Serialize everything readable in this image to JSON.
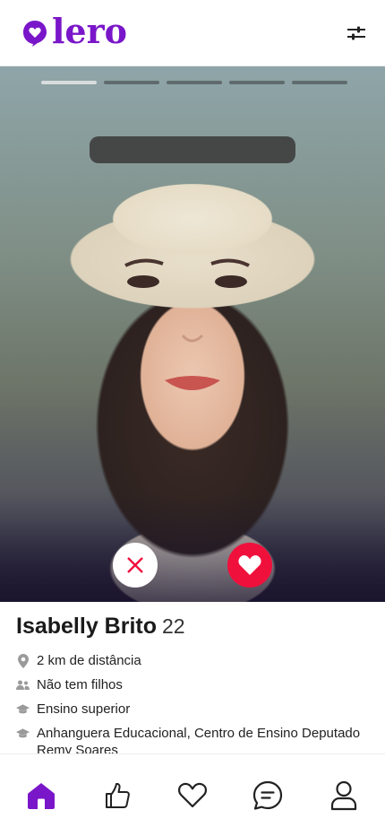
{
  "app": {
    "brand": "lero",
    "brand_color": "#7a16c9"
  },
  "header": {
    "filter_icon": "sliders-icon"
  },
  "photo": {
    "progress_total": 5,
    "progress_active": 0
  },
  "actions": {
    "dislike_icon": "close-icon",
    "like_icon": "heart-icon",
    "like_color": "#f0103c"
  },
  "profile": {
    "name": "Isabelly Brito",
    "age": "22",
    "details": [
      {
        "icon": "location-pin-icon",
        "text": "2 km de distância"
      },
      {
        "icon": "people-icon",
        "text": "Não tem filhos"
      },
      {
        "icon": "graduation-cap-icon",
        "text": "Ensino superior"
      },
      {
        "icon": "graduation-cap-icon",
        "text": "Anhanguera Educacional, Centro de Ensino Deputado Remy Soares"
      }
    ]
  },
  "nav": {
    "items": [
      {
        "icon": "home-icon",
        "active": true
      },
      {
        "icon": "thumbs-up-icon",
        "active": false
      },
      {
        "icon": "heart-icon",
        "active": false
      },
      {
        "icon": "chat-icon",
        "active": false
      },
      {
        "icon": "profile-icon",
        "active": false
      }
    ],
    "active_color": "#7a16c9"
  }
}
